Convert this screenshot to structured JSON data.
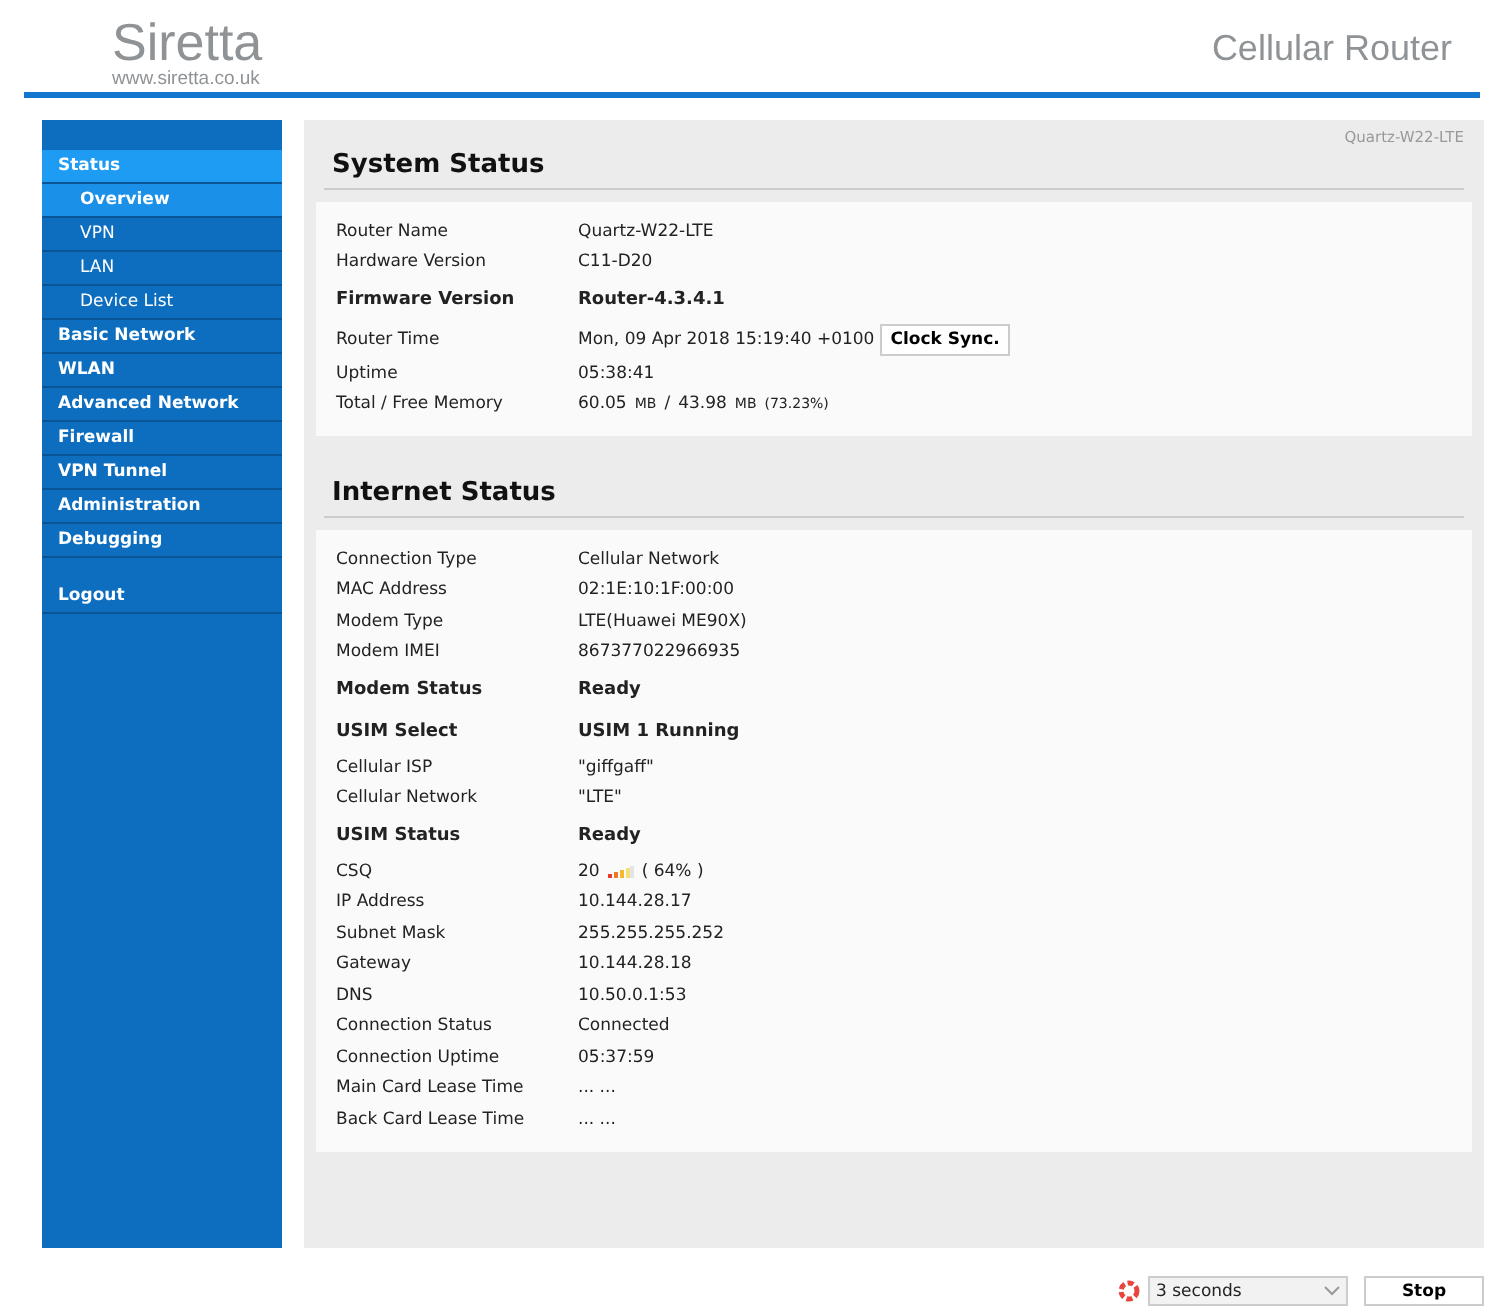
{
  "header": {
    "logo": "Siretta",
    "logo_url": "www.siretta.co.uk",
    "product": "Cellular Router"
  },
  "sidebar": {
    "items": [
      {
        "label": "Status",
        "kind": "section",
        "selected": true
      },
      {
        "label": "Overview",
        "kind": "sub",
        "selected": true
      },
      {
        "label": "VPN",
        "kind": "sub",
        "selected": false
      },
      {
        "label": "LAN",
        "kind": "sub",
        "selected": false
      },
      {
        "label": "Device List",
        "kind": "sub",
        "selected": false
      },
      {
        "label": "Basic Network",
        "kind": "section",
        "selected": false
      },
      {
        "label": "WLAN",
        "kind": "section",
        "selected": false
      },
      {
        "label": "Advanced Network",
        "kind": "section",
        "selected": false
      },
      {
        "label": "Firewall",
        "kind": "section",
        "selected": false
      },
      {
        "label": "VPN Tunnel",
        "kind": "section",
        "selected": false
      },
      {
        "label": "Administration",
        "kind": "section",
        "selected": false
      },
      {
        "label": "Debugging",
        "kind": "section",
        "selected": false
      },
      {
        "label": "Logout",
        "kind": "logout",
        "selected": false
      }
    ]
  },
  "device_name": "Quartz-W22-LTE",
  "sections": [
    {
      "title": "System Status",
      "rows": [
        {
          "kind": "plain",
          "label": "Router Name",
          "value": "Quartz-W22-LTE"
        },
        {
          "kind": "plain",
          "label": "Hardware Version",
          "value": "C11-D20"
        },
        {
          "kind": "bold",
          "label": "Firmware Version",
          "value": "Router-4.3.4.1"
        },
        {
          "kind": "button",
          "label": "Router Time",
          "value": "Mon, 09 Apr 2018 15:19:40 +0100",
          "button": "Clock Sync."
        },
        {
          "kind": "plain",
          "label": "Uptime",
          "value": "05:38:41"
        },
        {
          "kind": "parts",
          "label": "Total / Free Memory",
          "parts": [
            {
              "text": "60.05",
              "small": false
            },
            {
              "text": "MB",
              "small": true
            },
            {
              "text": "/",
              "small": false
            },
            {
              "text": "43.98",
              "small": false
            },
            {
              "text": "MB",
              "small": true
            },
            {
              "text": "(73.23%)",
              "small": true
            }
          ]
        }
      ]
    },
    {
      "title": "Internet Status",
      "rows": [
        {
          "kind": "plain",
          "label": "Connection Type",
          "value": "Cellular Network"
        },
        {
          "kind": "plain",
          "label": "MAC Address",
          "value": "02:1E:10:1F:00:00"
        },
        {
          "kind": "plain",
          "label": "Modem Type",
          "value": "LTE(Huawei ME90X)"
        },
        {
          "kind": "plain",
          "label": "Modem IMEI",
          "value": "867377022966935"
        },
        {
          "kind": "bold",
          "label": "Modem Status",
          "value": "Ready"
        },
        {
          "kind": "bold",
          "label": "USIM Select",
          "value": "USIM 1 Running"
        },
        {
          "kind": "plain",
          "label": "Cellular ISP",
          "value": "\"giffgaff\""
        },
        {
          "kind": "plain",
          "label": "Cellular Network",
          "value": "\"LTE\""
        },
        {
          "kind": "bold",
          "label": "USIM Status",
          "value": "Ready"
        },
        {
          "kind": "signal",
          "label": "CSQ",
          "value": "20",
          "after": "( 64% )"
        },
        {
          "kind": "plain",
          "label": "IP Address",
          "value": "10.144.28.17"
        },
        {
          "kind": "plain",
          "label": "Subnet Mask",
          "value": "255.255.255.252"
        },
        {
          "kind": "plain",
          "label": "Gateway",
          "value": "10.144.28.18"
        },
        {
          "kind": "plain",
          "label": "DNS",
          "value": "10.50.0.1:53"
        },
        {
          "kind": "plain",
          "label": "Connection Status",
          "value": "Connected"
        },
        {
          "kind": "plain",
          "label": "Connection Uptime",
          "value": "05:37:59"
        },
        {
          "kind": "plain",
          "label": "Main Card Lease Time",
          "value": "... ..."
        },
        {
          "kind": "plain",
          "label": "Back Card Lease Time",
          "value": "... ..."
        }
      ]
    }
  ],
  "footer": {
    "refresh": "3 seconds",
    "stop": "Stop"
  }
}
